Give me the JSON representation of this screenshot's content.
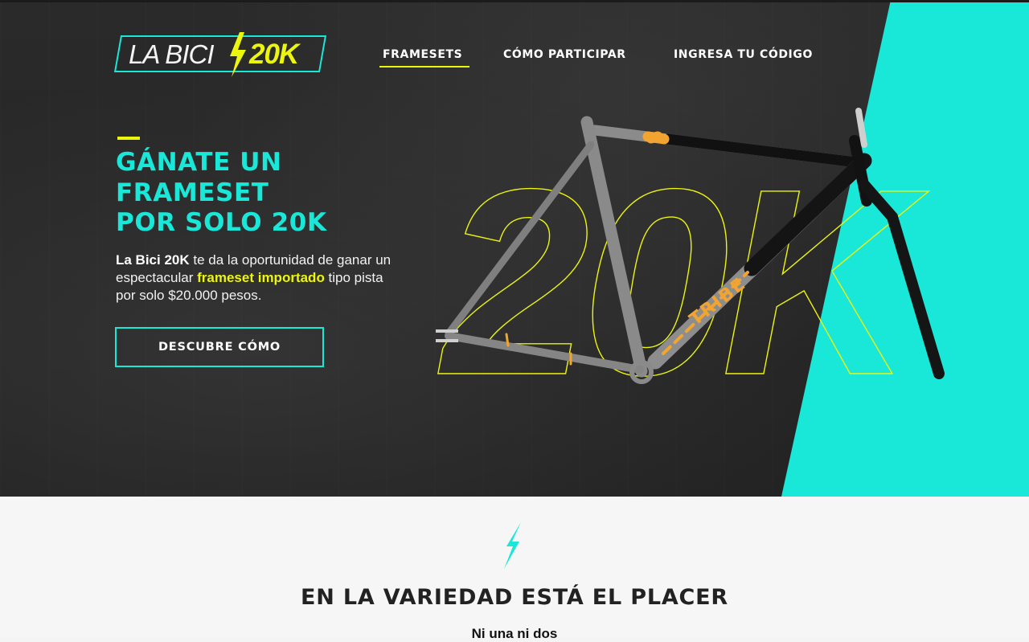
{
  "header": {
    "logo": {
      "text": "LA BICI",
      "number": "20K"
    },
    "nav": [
      {
        "label": "FRAMESETS",
        "active": true
      },
      {
        "label": "CÓMO PARTICIPAR",
        "active": false
      },
      {
        "label": "INGRESA TU CÓDIGO",
        "active": false
      }
    ]
  },
  "hero": {
    "headline_lines": [
      "GÁNATE UN",
      "FRAMESET",
      "POR SOLO 20K"
    ],
    "intro": {
      "brand": "La Bici 20K",
      "part1": " te da la oportunidad de ganar un espectacular ",
      "highlight": "frameset importado",
      "part2": " tipo pista por solo $20.000 pesos."
    },
    "cta_label": "DESCUBRE CÓMO",
    "background_text": "20K",
    "frame_decal": "TRIBE"
  },
  "section": {
    "title": "EN LA VARIEDAD ESTÁ EL PLACER",
    "subtitle": "Ni una ni dos"
  },
  "colors": {
    "accent_teal": "#19e8d8",
    "accent_yellow": "#ecf50c",
    "hero_bg": "#262626",
    "section_bg": "#f6f6f6"
  },
  "icons": [
    "lightning-bolt-icon"
  ]
}
